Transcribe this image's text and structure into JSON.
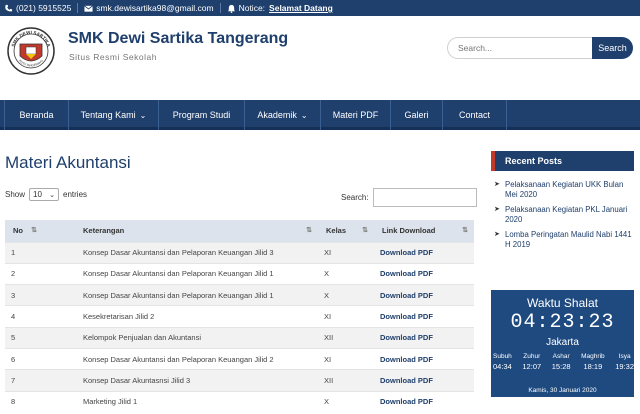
{
  "topbar": {
    "phone": "(021) 5915525",
    "email": "smk.dewisartika98@gmail.com",
    "notice_label": "Notice:",
    "notice_text": "Selamat Datang"
  },
  "header": {
    "logo_text": "SMK DEWI SARTIKA",
    "logo_subtext": "KOTA TANGERANG",
    "title": "SMK Dewi Sartika Tangerang",
    "tagline": "Situs Resmi Sekolah",
    "search_placeholder": "Search...",
    "search_button": "Search"
  },
  "nav": {
    "items": [
      {
        "label": "Beranda",
        "dropdown": false
      },
      {
        "label": "Tentang Kami",
        "dropdown": true
      },
      {
        "label": "Program Studi",
        "dropdown": false
      },
      {
        "label": "Akademik",
        "dropdown": true
      },
      {
        "label": "Materi PDF",
        "dropdown": false
      },
      {
        "label": "Galeri",
        "dropdown": false
      },
      {
        "label": "Contact",
        "dropdown": false
      }
    ]
  },
  "main": {
    "title": "Materi Akuntansi",
    "show_label": "Show",
    "show_value": "10",
    "entries_label": "entries",
    "search_label": "Search:",
    "table": {
      "headers": [
        "No",
        "Keterangan",
        "Kelas",
        "Link Download"
      ],
      "rows": [
        {
          "no": "1",
          "keterangan": "Konsep Dasar Akuntansi dan Pelaporan Keuangan Jilid 3",
          "kelas": "XI",
          "link": "Download PDF"
        },
        {
          "no": "2",
          "keterangan": "Konsep Dasar Akuntansi dan Pelaporan Keuangan Jilid 1",
          "kelas": "X",
          "link": "Download PDF"
        },
        {
          "no": "3",
          "keterangan": "Konsep Dasar Akuntansi dan Pelaporan Keuangan Jilid 1",
          "kelas": "X",
          "link": "Download PDF"
        },
        {
          "no": "4",
          "keterangan": "Kesekretarisan Jilid 2",
          "kelas": "XI",
          "link": "Download PDF"
        },
        {
          "no": "5",
          "keterangan": "Kelompok Penjualan dan Akuntansi",
          "kelas": "XII",
          "link": "Download PDF"
        },
        {
          "no": "6",
          "keterangan": "Konsep Dasar Akuntansi dan Pelaporan Keuangan Jilid 2",
          "kelas": "XI",
          "link": "Download PDF"
        },
        {
          "no": "7",
          "keterangan": "Konsep Dasar Akuntasnsi Jilid 3",
          "kelas": "XII",
          "link": "Download PDF"
        },
        {
          "no": "8",
          "keterangan": "Marketing Jilid 1",
          "kelas": "X",
          "link": "Download PDF"
        }
      ]
    }
  },
  "sidebar": {
    "recent_title": "Recent Posts",
    "posts": [
      "Pelaksanaan Kegiatan UKK Bulan Mei 2020",
      "Pelaksanaan Kegiatan PKL Januari 2020",
      "Lomba Peringatan Maulid Nabi 1441 H 2019"
    ],
    "shalat": {
      "title": "Waktu Shalat",
      "time": "04:23:23",
      "city": "Jakarta",
      "times": [
        {
          "name": "Subuh",
          "time": "04:34"
        },
        {
          "name": "Zuhur",
          "time": "12:07"
        },
        {
          "name": "Ashar",
          "time": "15:28"
        },
        {
          "name": "Maghrib",
          "time": "18:19"
        },
        {
          "name": "Isya",
          "time": "19:32"
        }
      ],
      "date": "Kamis, 30 Januari 2020"
    }
  },
  "colors": {
    "primary": "#1f3f6c",
    "accent": "#c0392b",
    "table_header": "#dde3ec"
  }
}
